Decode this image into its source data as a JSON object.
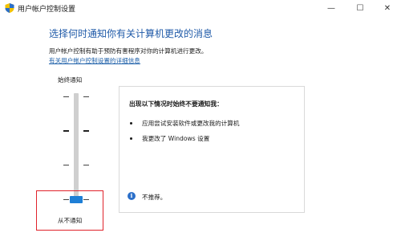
{
  "window": {
    "title": "用户帐户控制设置",
    "controls": {
      "minimize": "—",
      "maximize": "☐",
      "close": "✕"
    }
  },
  "main": {
    "heading": "选择何时通知你有关计算机更改的消息",
    "description": "用户帐户控制有助于预防有害程序对你的计算机进行更改。",
    "more_link": "有关用户帐户控制设置的详细信息"
  },
  "slider": {
    "top_label": "始终通知",
    "bottom_label": "从不通知",
    "levels": 4,
    "selected_level": 1,
    "accent": "#1e7fd6",
    "highlight_color": "#e0232b"
  },
  "panel": {
    "title": "出现以下情况时始终不要通知我：",
    "bullets": [
      "应用尝试安装软件或更改我的计算机",
      "我更改了 Windows 设置"
    ],
    "info_text": "不推荐。",
    "info_icon": "info-icon"
  },
  "colors": {
    "heading": "#1f5aa8",
    "link": "#1b5ea8"
  }
}
